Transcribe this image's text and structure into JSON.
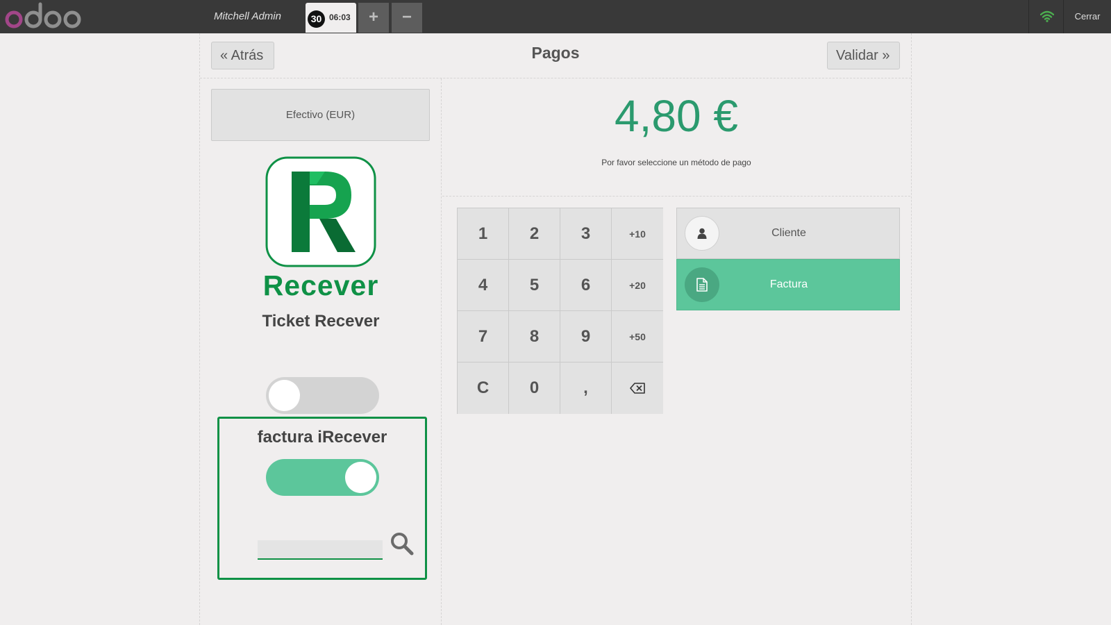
{
  "app": {
    "logo_text": "odoo"
  },
  "topbar": {
    "cashier": "Mitchell Admin",
    "order_tab": {
      "badge": "30",
      "time": "06:03"
    },
    "add_label": "+",
    "remove_label": "−",
    "close_label": "Cerrar"
  },
  "header": {
    "back_label": "« Atrás",
    "title": "Pagos",
    "next_label": "Validar »"
  },
  "payment_methods": [
    {
      "label": "Efectivo (EUR)"
    }
  ],
  "recever": {
    "brand": "Recever",
    "ticket_label": "Ticket Recever",
    "ticket_enabled": false,
    "invoice_label": "factura iRecever",
    "invoice_enabled": true,
    "search_value": ""
  },
  "payment": {
    "amount": "4,80 €",
    "hint": "Por favor seleccione un método de pago"
  },
  "numpad": {
    "keys": [
      "1",
      "2",
      "3",
      "+10",
      "4",
      "5",
      "6",
      "+20",
      "7",
      "8",
      "9",
      "+50",
      "C",
      "0",
      ",",
      "⌫"
    ]
  },
  "actions": {
    "customer_label": "Cliente",
    "invoice_label": "Factura"
  },
  "colors": {
    "brand_green": "#0f9146",
    "accent_teal": "#5cc69b",
    "amount_green": "#2b9a6e",
    "topbar": "#393939",
    "wifi_green": "#4caf50"
  },
  "icons": [
    "odoo-logo",
    "wifi-icon",
    "recever-logo",
    "search-icon",
    "user-icon",
    "file-icon",
    "backspace-icon"
  ]
}
